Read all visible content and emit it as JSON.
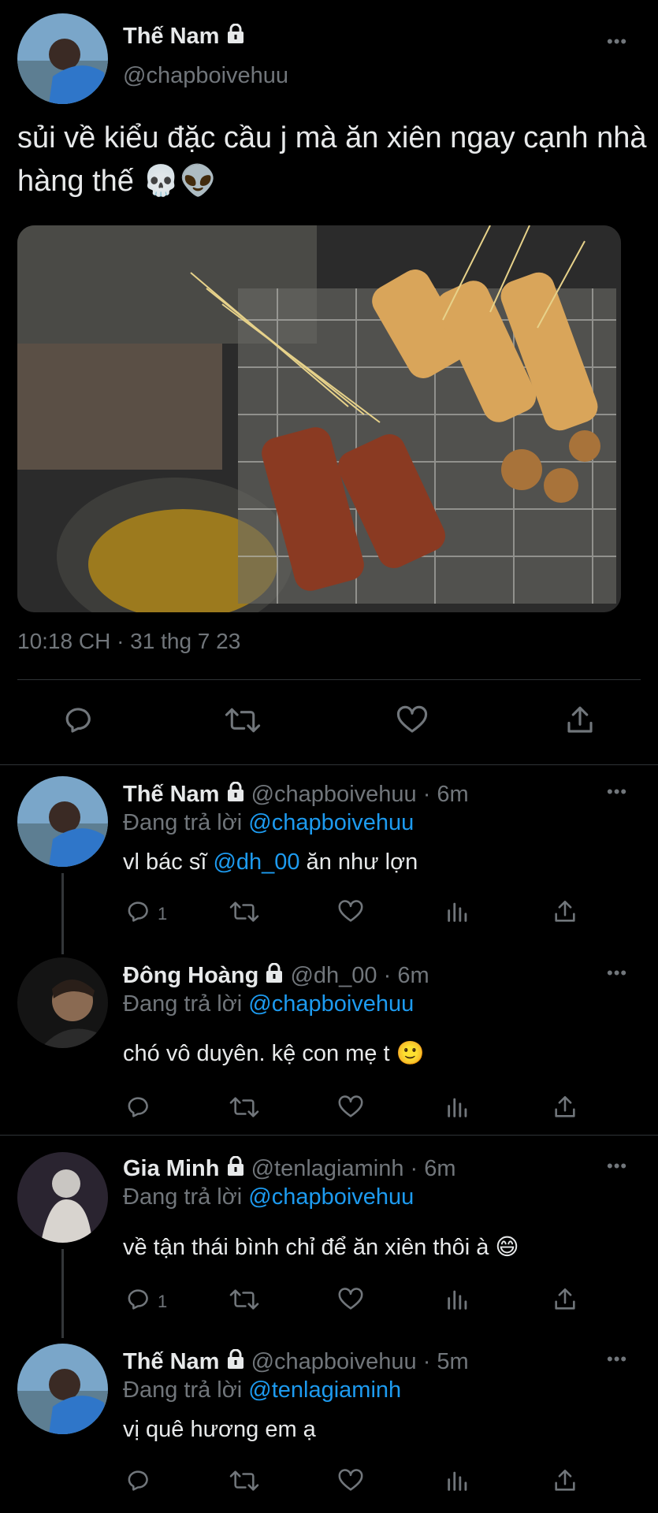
{
  "main_tweet": {
    "display_name": "Thế Nam",
    "handle": "@chapboivehuu",
    "text": "sủi về kiểu đặc cầu j mà ăn xiên ngay cạnh nhà hàng thế 💀👽",
    "timestamp": "10:18 CH · 31 thg 7 23"
  },
  "replies": [
    {
      "display_name": "Thế Nam",
      "handle": "@chapboivehuu",
      "time": "· 6m",
      "replying_prefix": "Đang trả lời",
      "replying_to": "@chapboivehuu",
      "text_before": "vl bác sĩ ",
      "mention": "@dh_00",
      "text_after": " ăn như lợn",
      "reply_count": "1"
    },
    {
      "display_name": "Đông Hoàng",
      "handle": "@dh_00",
      "time": "· 6m",
      "replying_prefix": "Đang trả lời",
      "replying_to": "@chapboivehuu",
      "text": "chó vô duyên. kệ con mẹ t 🙂"
    },
    {
      "display_name": "Gia Minh",
      "handle": "@tenlagiaminh",
      "time": "· 6m",
      "replying_prefix": "Đang trả lời",
      "replying_to": "@chapboivehuu",
      "text": "về tận thái bình chỉ để ăn xiên thôi à 😄",
      "reply_count": "1"
    },
    {
      "display_name": "Thế Nam",
      "handle": "@chapboivehuu",
      "time": "· 5m",
      "replying_prefix": "Đang trả lời",
      "replying_to": "@tenlagiaminh",
      "text": "vị quê hương em ạ"
    }
  ],
  "icons": {
    "reply": "reply-icon",
    "retweet": "retweet-icon",
    "like": "heart-icon",
    "views": "views-icon",
    "share": "share-icon",
    "more": "more-icon",
    "lock": "lock-icon"
  },
  "colors": {
    "background": "#000000",
    "text": "#e7e9ea",
    "muted": "#71767b",
    "link": "#1d9bf0",
    "divider": "#2f3336"
  }
}
